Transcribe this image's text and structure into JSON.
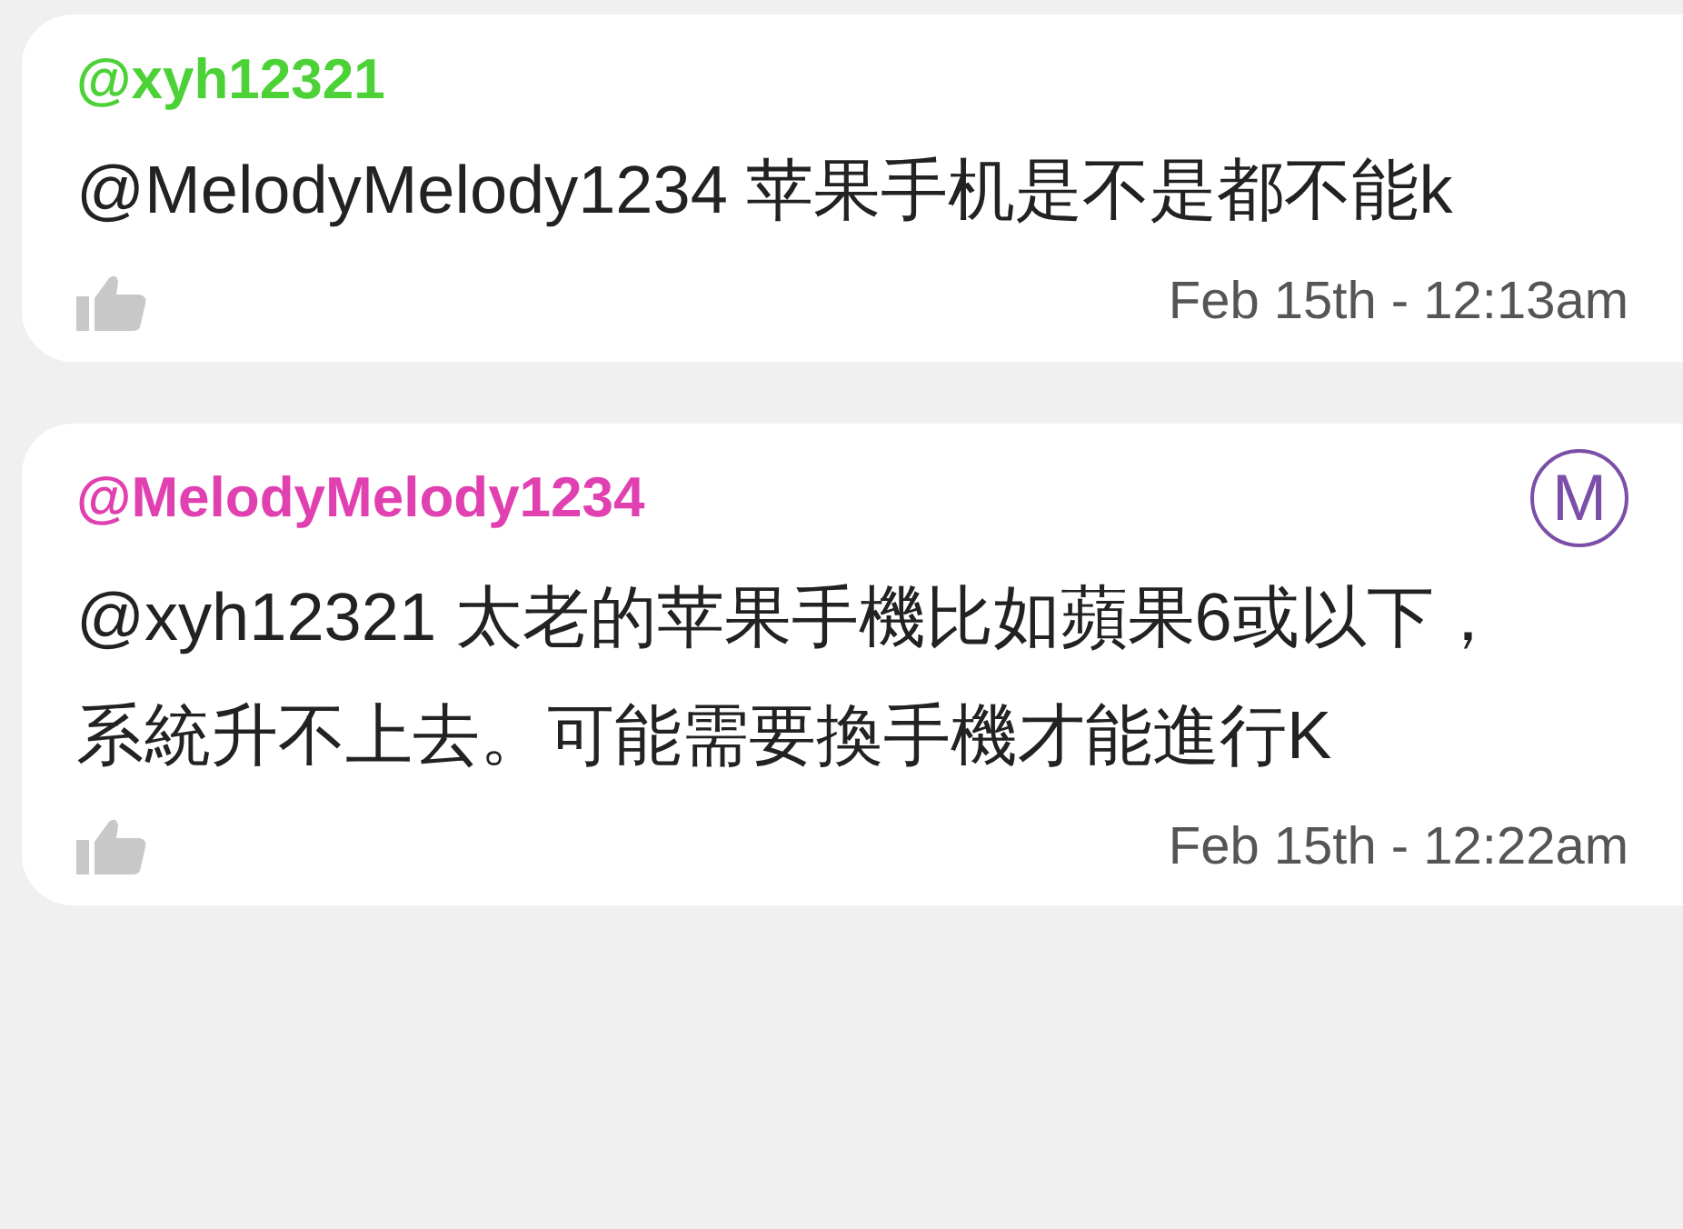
{
  "messages": [
    {
      "username": "@xyh12321",
      "color": "#4cd137",
      "text": "@MelodyMelody1234 苹果手机是不是都不能k",
      "time": "Feb 15th - 12:13am"
    },
    {
      "username": "@MelodyMelody1234",
      "color": "#e040b0",
      "avatar": "M",
      "text": "@xyh12321 太老的苹果手機比如蘋果6或以下，系統升不上去。可能需要換手機才能進行K",
      "time": "Feb 15th - 12:22am"
    }
  ]
}
